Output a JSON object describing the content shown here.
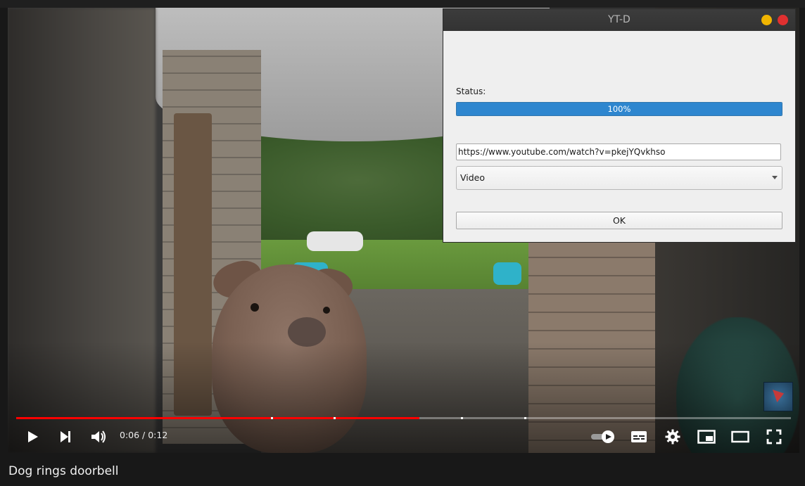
{
  "player": {
    "time_display": "0:06 / 0:12",
    "progress_fraction": 0.52,
    "chapter_markers": [
      0.329,
      0.41,
      0.574,
      0.656
    ],
    "accent_color": "#ff0000",
    "controls": {
      "play": "play-icon",
      "next": "next-icon",
      "volume": "volume-icon",
      "autoplay": "autoplay-toggle-icon",
      "subtitles": "subtitles-icon",
      "settings": "gear-icon",
      "miniplayer": "miniplayer-icon",
      "theater": "theater-mode-icon",
      "fullscreen": "fullscreen-icon"
    }
  },
  "video": {
    "title": "Dog rings doorbell"
  },
  "dialog": {
    "title": "YT-D",
    "status_label": "Status:",
    "progress_text": "100%",
    "progress_value": 1.0,
    "url_value": "https://www.youtube.com/watch?v=pkejYQvkhso",
    "format_selected": "Video",
    "ok_label": "OK",
    "colors": {
      "minimize": "#f0b400",
      "close": "#e03030",
      "progress": "#2e86cf"
    }
  }
}
